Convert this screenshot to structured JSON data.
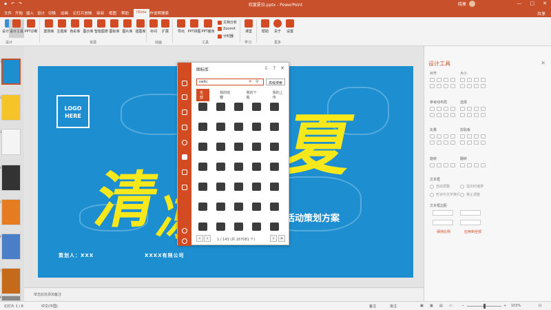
{
  "window": {
    "title": "欢度夏日.pptx - PowerPoint",
    "user": "晓莫",
    "controls": [
      "—",
      "□",
      "✕"
    ]
  },
  "menu": {
    "tabs": [
      "文件",
      "开始",
      "插入",
      "设计",
      "切换",
      "动画",
      "幻灯片放映",
      "审阅",
      "视图",
      "帮助",
      "iSlide",
      "操作说明搜索"
    ],
    "active_index": 10,
    "share": "共享"
  },
  "ribbon": {
    "buttons": [
      {
        "label": "设计排版",
        "icon": "layout-icon"
      },
      {
        "label": "设计工具",
        "icon": "design-tools-icon",
        "selected": true
      },
      {
        "label": "PPT诊断",
        "icon": "diagnose-icon"
      },
      {
        "label": "案例库",
        "icon": "case-library-icon"
      },
      {
        "label": "主题库",
        "icon": "theme-library-icon"
      },
      {
        "label": "色彩库",
        "icon": "color-library-icon"
      },
      {
        "label": "图示库",
        "icon": "diagram-library-icon"
      },
      {
        "label": "智能图表",
        "icon": "smart-chart-icon"
      },
      {
        "label": "图标库",
        "icon": "icon-library-icon"
      },
      {
        "label": "图片库",
        "icon": "image-library-icon"
      },
      {
        "label": "插图库",
        "icon": "illustration-library-icon"
      },
      {
        "label": "补间",
        "icon": "tween-icon"
      },
      {
        "label": "扩展",
        "icon": "extend-icon"
      },
      {
        "label": "导出",
        "icon": "export-icon"
      },
      {
        "label": "PPT拼图",
        "icon": "puzzle-icon"
      },
      {
        "label": "PPT瘦身",
        "icon": "slim-icon"
      },
      {
        "label": "课堂",
        "icon": "classroom-icon"
      },
      {
        "label": "帮助",
        "icon": "help-icon"
      },
      {
        "label": "关于",
        "icon": "about-icon"
      },
      {
        "label": "设置",
        "icon": "settings-icon"
      }
    ],
    "small": [
      "文档分析",
      "ZoomIt",
      "计时器"
    ],
    "groups": [
      "设计",
      "资源",
      "动画",
      "工具",
      "学习",
      "更多"
    ]
  },
  "slide": {
    "logo_lines": [
      "LOGO",
      "HERE"
    ],
    "heading_chars": [
      "清",
      "凉",
      "夏"
    ],
    "subtitle": "活动策划方案",
    "planner": "策划人：XXX",
    "company": "XXXX有限公司"
  },
  "thumbnails": [
    "1",
    "2",
    "3",
    "4",
    "5",
    "6",
    "7",
    "8"
  ],
  "notes_placeholder": "单击此处添加备注",
  "status": {
    "left": "幻灯片 1 / 8",
    "lang": "中文(中国)",
    "notes": "备注",
    "comments": "批注",
    "zoom": "103%"
  },
  "design_panel": {
    "title": "设计工具",
    "sections": [
      "对齐",
      "大小",
      "参考线布局",
      "选择",
      "矢量",
      "剪贴板",
      "旋转",
      "翻转",
      "文本框",
      "文本框边距"
    ],
    "textbox_options": [
      "自动调整",
      "溢出时缩排",
      "形状中文字换行",
      "禁止调整"
    ],
    "links": [
      "保持比例",
      "应用到全部"
    ]
  },
  "icon_dialog": {
    "title": "图标库",
    "search_value": "switc",
    "search_button": "高级搜索",
    "tabs": [
      "全部",
      "我的收藏",
      "我的下载",
      "我的上传"
    ],
    "active_tab": 0,
    "pager": "1 / 143 (共 167081 个)",
    "icons": [
      "keys-icon",
      "frame-icon",
      "feather-icon",
      "export-box-icon",
      "book-icon",
      "bus-icon",
      "bowling-icon",
      "card-icon",
      "pen-icon",
      "runner-icon",
      "arrow-left-circle-icon",
      "copy-icon",
      "backpack-icon",
      "angry-face-icon",
      "cap-icon",
      "jacket-icon",
      "voicemail-icon",
      "lantern-icon",
      "pie-chart-icon",
      "amazon-icon",
      "bookmark-icon",
      "bench-icon",
      "cart-icon",
      "bottle-icon",
      "bed-icon",
      "spray-icon",
      "updown-arrow-icon",
      "s-curve-icon",
      "folder-icon",
      "basket-icon",
      "road-icon",
      "camera-icon",
      "frame-f-icon",
      "people-icon",
      "grid-icon"
    ]
  }
}
